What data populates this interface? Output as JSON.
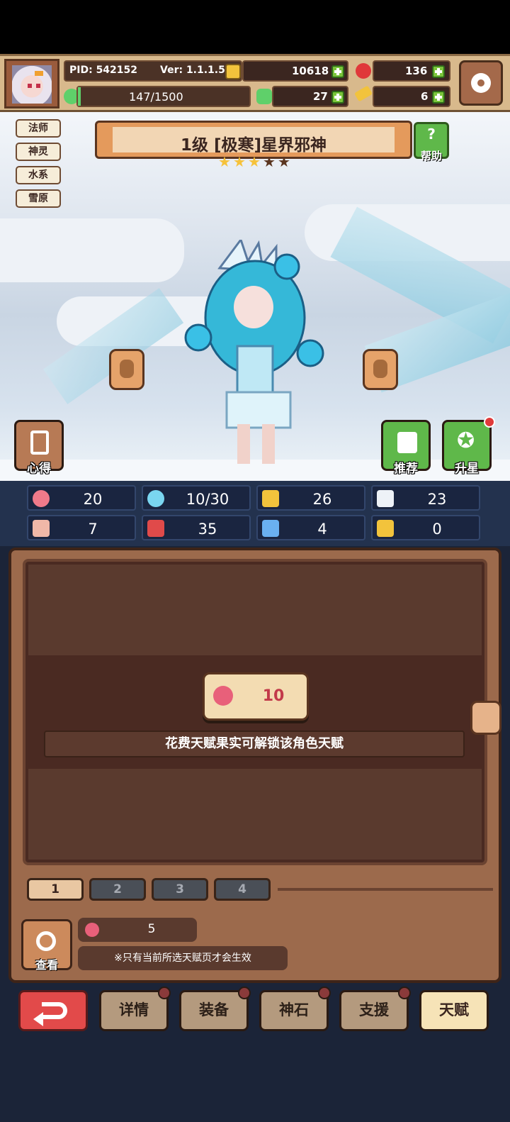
{
  "header": {
    "pid": "PID: 542152",
    "version": "Ver: 1.1.1.5",
    "gold": "10618",
    "ruby": "136",
    "energy": "147/1500",
    "clover": "27",
    "key": "6"
  },
  "hero": {
    "tags": [
      "法师",
      "神灵",
      "水系",
      "雪原"
    ],
    "title": "1级 [极寒]星界邪神",
    "stars_filled": 3,
    "stars_total": 5,
    "help_label": "帮助",
    "notes_label": "心得",
    "recommend_label": "推荐",
    "star_up_label": "升星"
  },
  "stats": [
    {
      "icon": "heart-icon",
      "value": "20"
    },
    {
      "icon": "mana-drop-icon",
      "value": "10/30"
    },
    {
      "icon": "shield-icon",
      "value": "26"
    },
    {
      "icon": "wing-icon",
      "value": "23"
    },
    {
      "icon": "fist-icon",
      "value": "7"
    },
    {
      "icon": "book-icon",
      "value": "35"
    },
    {
      "icon": "scroll-icon",
      "value": "4"
    },
    {
      "icon": "crown-icon",
      "value": "0"
    }
  ],
  "talent": {
    "cost": "10",
    "hint": "花费天赋果实可解锁该角色天赋",
    "tabs": [
      "1",
      "2",
      "3",
      "4"
    ],
    "active_tab": 0,
    "owned_fruit": "5",
    "view_label": "查看",
    "note": "※只有当前所选天赋页才会生效"
  },
  "nav": {
    "items": [
      "详情",
      "装备",
      "神石",
      "支援",
      "天赋"
    ],
    "active": "天赋"
  },
  "colors": {
    "accent": "#e49a5c",
    "panel": "#9c6a4c",
    "stats_bg": "#23324e",
    "back": "#e24a4a",
    "green": "#5fb84a"
  }
}
